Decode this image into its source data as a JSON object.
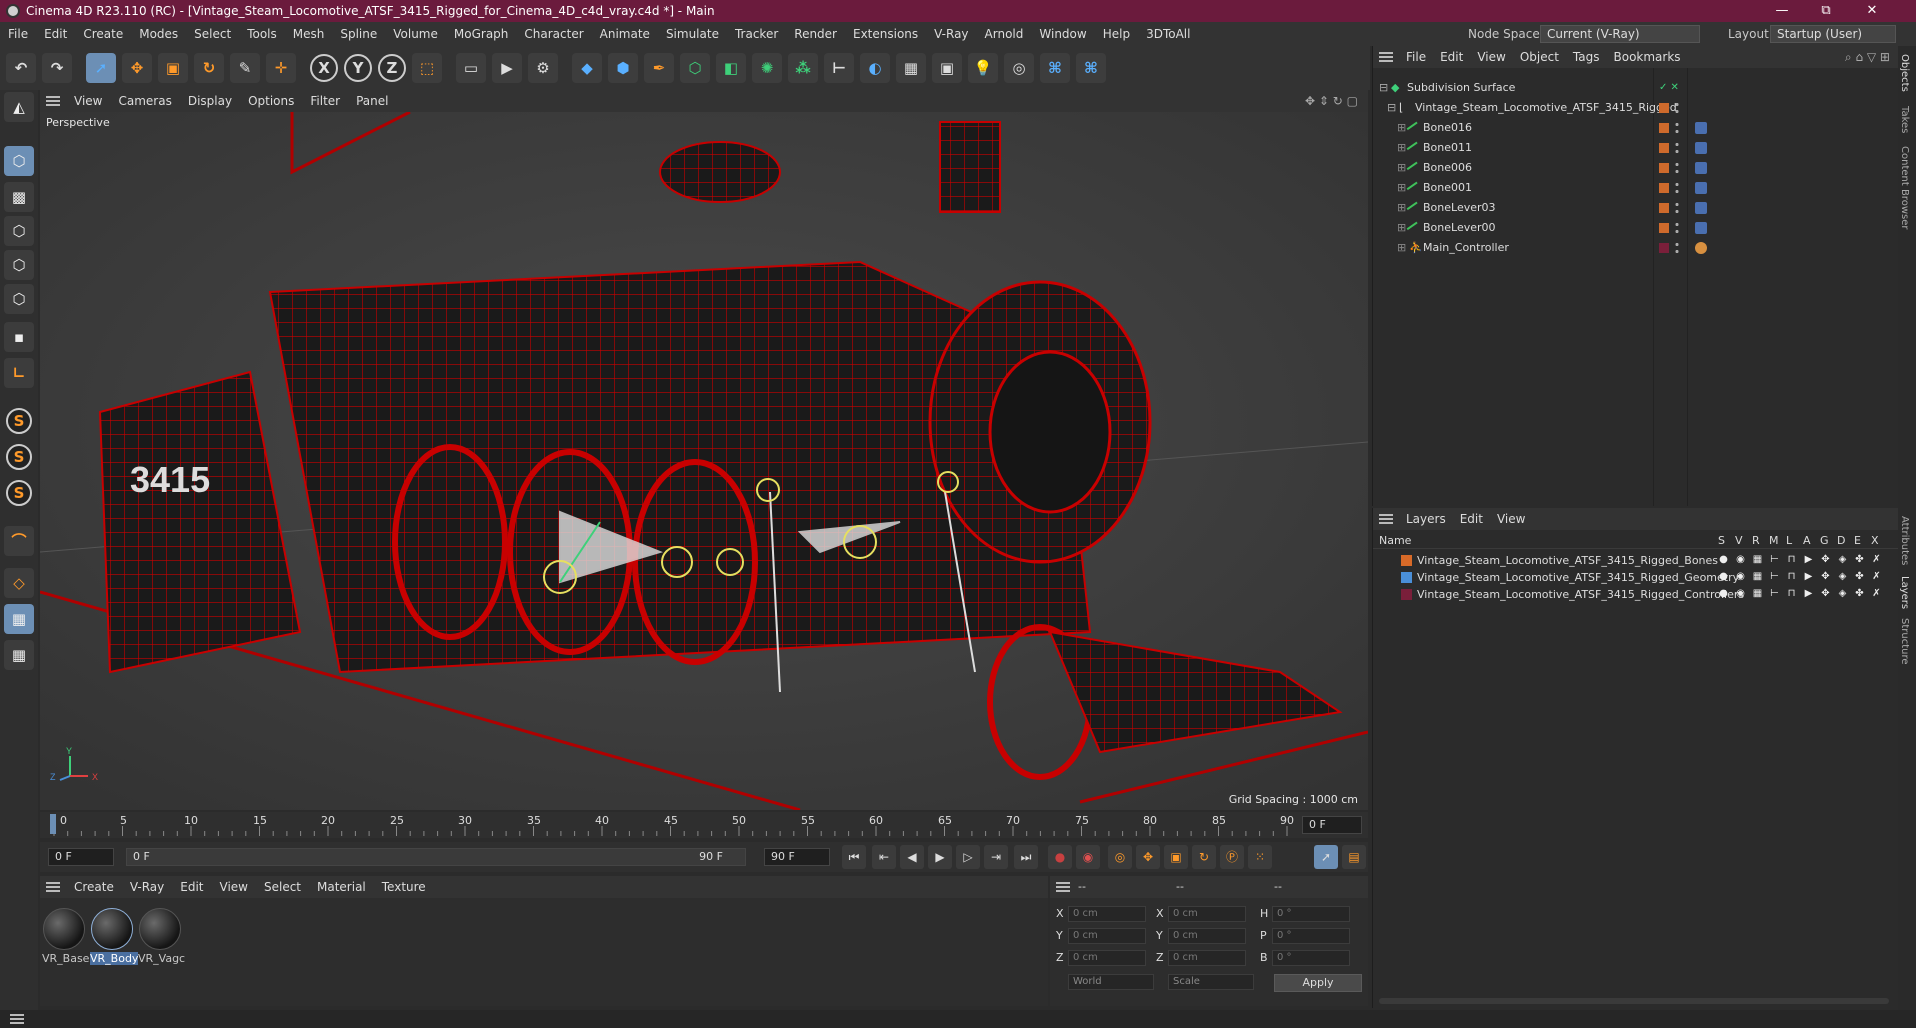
{
  "window": {
    "title": "Cinema 4D R23.110 (RC) - [Vintage_Steam_Locomotive_ATSF_3415_Rigged_for_Cinema_4D_c4d_vray.c4d *] - Main",
    "minimize": "—",
    "maximize": "⧉",
    "close": "✕"
  },
  "menubar": {
    "items": [
      "File",
      "Edit",
      "Create",
      "Modes",
      "Select",
      "Tools",
      "Mesh",
      "Spline",
      "Volume",
      "MoGraph",
      "Character",
      "Animate",
      "Simulate",
      "Tracker",
      "Render",
      "Extensions",
      "V-Ray",
      "Arnold",
      "Window",
      "Help",
      "3DToAll"
    ],
    "node_space_label": "Node Space:",
    "node_space_value": "Current (V-Ray)",
    "layout_label": "Layout:",
    "layout_value": "Startup (User)"
  },
  "toolbar": {
    "undo_icon": "undo-icon",
    "axis_x": "X",
    "axis_y": "Y",
    "axis_z": "Z"
  },
  "viewport": {
    "menu": [
      "View",
      "Cameras",
      "Display",
      "Options",
      "Filter",
      "Panel"
    ],
    "camera_label": "Perspective",
    "grid_spacing": "Grid Spacing : 1000 cm",
    "axis_x": "X",
    "axis_y": "Y",
    "axis_z": "Z",
    "wire_color": "#c80000"
  },
  "timeline": {
    "ticks": [
      "0",
      "5",
      "10",
      "15",
      "20",
      "25",
      "30",
      "35",
      "40",
      "45",
      "50",
      "55",
      "60",
      "65",
      "70",
      "75",
      "80",
      "85",
      "90"
    ],
    "current_frame_field": "0 F"
  },
  "transport": {
    "start_field": "0 F",
    "range_start": "0 F",
    "range_end": "90 F",
    "end_field": "90 F"
  },
  "materials": {
    "menu": [
      "Create",
      "V-Ray",
      "Edit",
      "View",
      "Select",
      "Material",
      "Texture"
    ],
    "items": [
      {
        "label": "VR_Base",
        "selected": false
      },
      {
        "label": "VR_Body",
        "selected": true
      },
      {
        "label": "VR_Vagc",
        "selected": false
      }
    ]
  },
  "coordinates": {
    "header": [
      "--",
      "--",
      "--"
    ],
    "rows": [
      {
        "a": "X",
        "av": "0 cm",
        "b": "X",
        "bv": "0 cm",
        "c": "H",
        "cv": "0 °"
      },
      {
        "a": "Y",
        "av": "0 cm",
        "b": "Y",
        "bv": "0 cm",
        "c": "P",
        "cv": "0 °"
      },
      {
        "a": "Z",
        "av": "0 cm",
        "b": "Z",
        "bv": "0 cm",
        "c": "B",
        "cv": "0 °"
      }
    ],
    "space": "World",
    "mode": "Scale",
    "apply": "Apply"
  },
  "objects": {
    "menu": [
      "File",
      "Edit",
      "View",
      "Object",
      "Tags",
      "Bookmarks"
    ],
    "tree": [
      {
        "name": "Subdivision Surface",
        "level": 0,
        "type": "subdiv"
      },
      {
        "name": "Vintage_Steam_Locomotive_ATSF_3415_Rigged",
        "level": 1,
        "type": "null"
      },
      {
        "name": "Bone016",
        "level": 2,
        "type": "bone"
      },
      {
        "name": "Bone011",
        "level": 2,
        "type": "bone"
      },
      {
        "name": "Bone006",
        "level": 2,
        "type": "bone"
      },
      {
        "name": "Bone001",
        "level": 2,
        "type": "bone"
      },
      {
        "name": "BoneLever03",
        "level": 2,
        "type": "bone"
      },
      {
        "name": "BoneLever00",
        "level": 2,
        "type": "bone"
      },
      {
        "name": "Main_Controller",
        "level": 2,
        "type": "controller"
      }
    ],
    "swatch_color": "#ce6a2c"
  },
  "layers": {
    "menu": [
      "Layers",
      "Edit",
      "View"
    ],
    "columns": [
      "Name",
      "S",
      "V",
      "R",
      "M",
      "L",
      "A",
      "G",
      "D",
      "E",
      "X"
    ],
    "rows": [
      {
        "name": "Vintage_Steam_Locomotive_ATSF_3415_Rigged_Bones",
        "color": "#d86a28"
      },
      {
        "name": "Vintage_Steam_Locomotive_ATSF_3415_Rigged_Geometry",
        "color": "#4a8fd8"
      },
      {
        "name": "Vintage_Steam_Locomotive_ATSF_3415_Rigged_Controllers",
        "color": "#7a1f3a"
      }
    ]
  },
  "side_tabs": [
    "Objects",
    "Takes",
    "Content Browser",
    "Attributes",
    "Layers",
    "Structure"
  ]
}
